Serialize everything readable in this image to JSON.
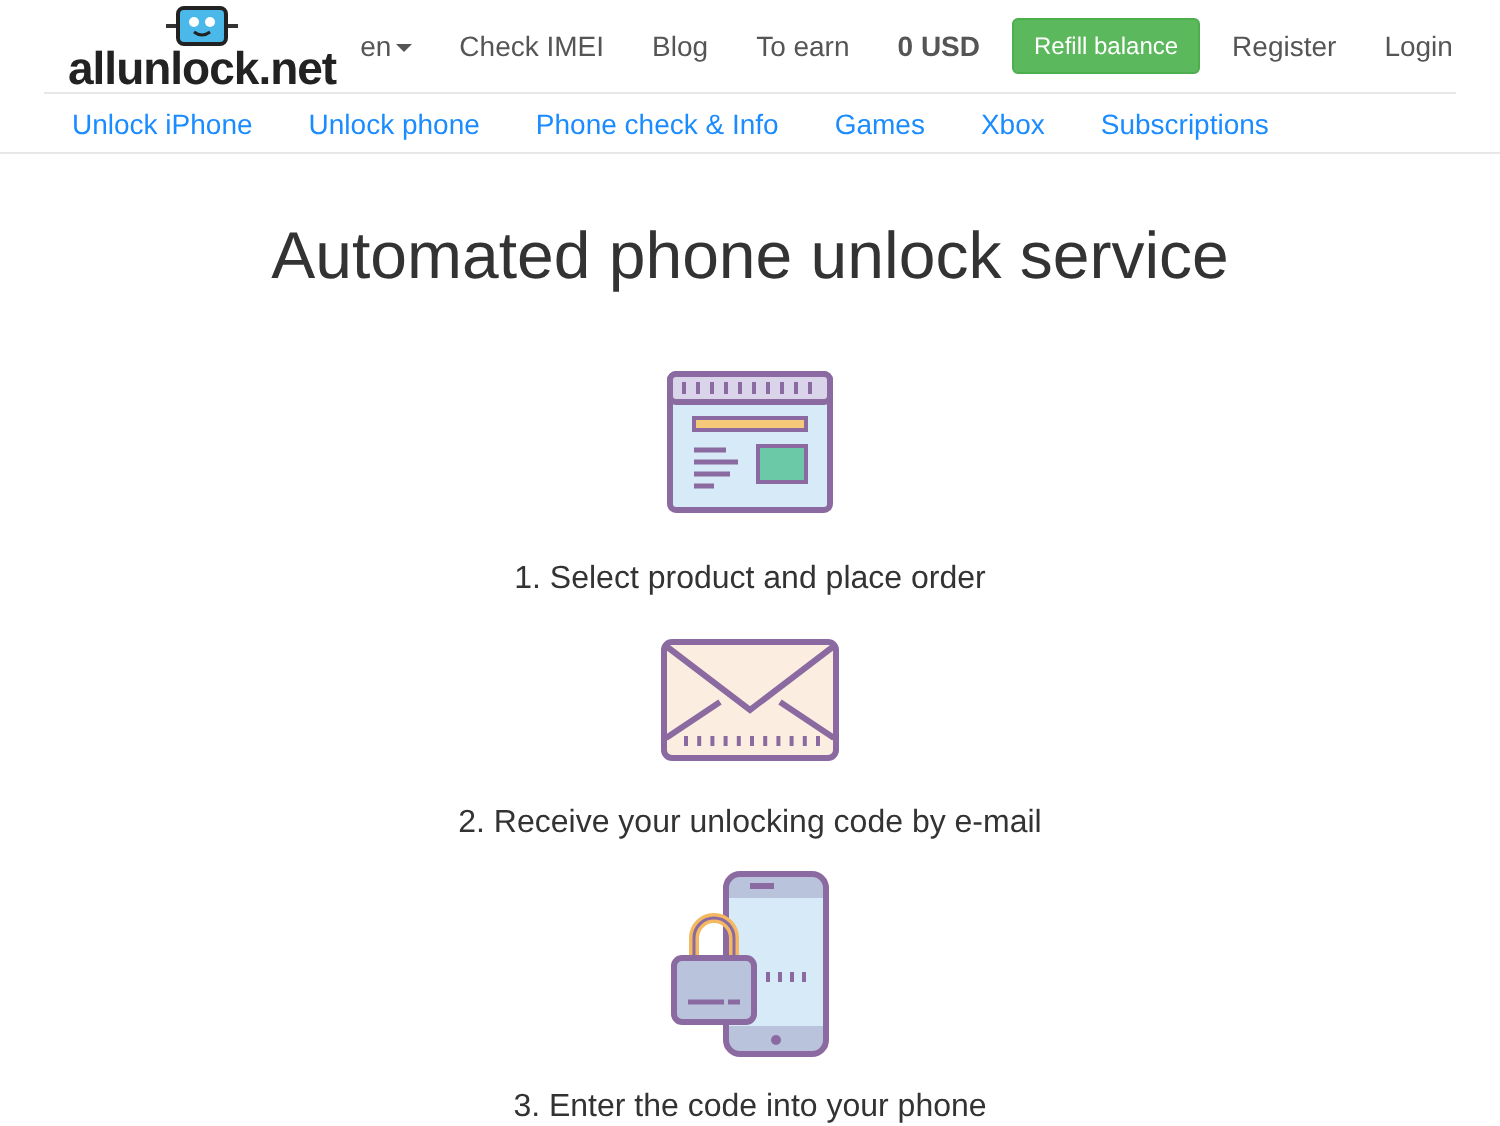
{
  "logo": {
    "text": "allunlock.net"
  },
  "top_nav": [
    {
      "label": "en",
      "kind": "dropdown"
    },
    {
      "label": "Check IMEI",
      "kind": "link"
    },
    {
      "label": "Blog",
      "kind": "link"
    },
    {
      "label": "To earn",
      "kind": "link"
    },
    {
      "label": "0 USD",
      "kind": "balance"
    },
    {
      "label": "Refill balance",
      "kind": "button"
    },
    {
      "label": "Register",
      "kind": "link"
    },
    {
      "label": "Login",
      "kind": "link"
    }
  ],
  "sub_nav": [
    {
      "label": "Unlock iPhone"
    },
    {
      "label": "Unlock phone"
    },
    {
      "label": "Phone check & Info"
    },
    {
      "label": "Games"
    },
    {
      "label": "Xbox"
    },
    {
      "label": "Subscriptions"
    }
  ],
  "heading": "Automated phone unlock service",
  "steps": [
    {
      "kind": "order",
      "text": "1. Select product and place order"
    },
    {
      "kind": "email",
      "text": "2. Receive your unlocking code by e-mail"
    },
    {
      "kind": "phone",
      "text": "3. Enter the code into your phone"
    }
  ]
}
